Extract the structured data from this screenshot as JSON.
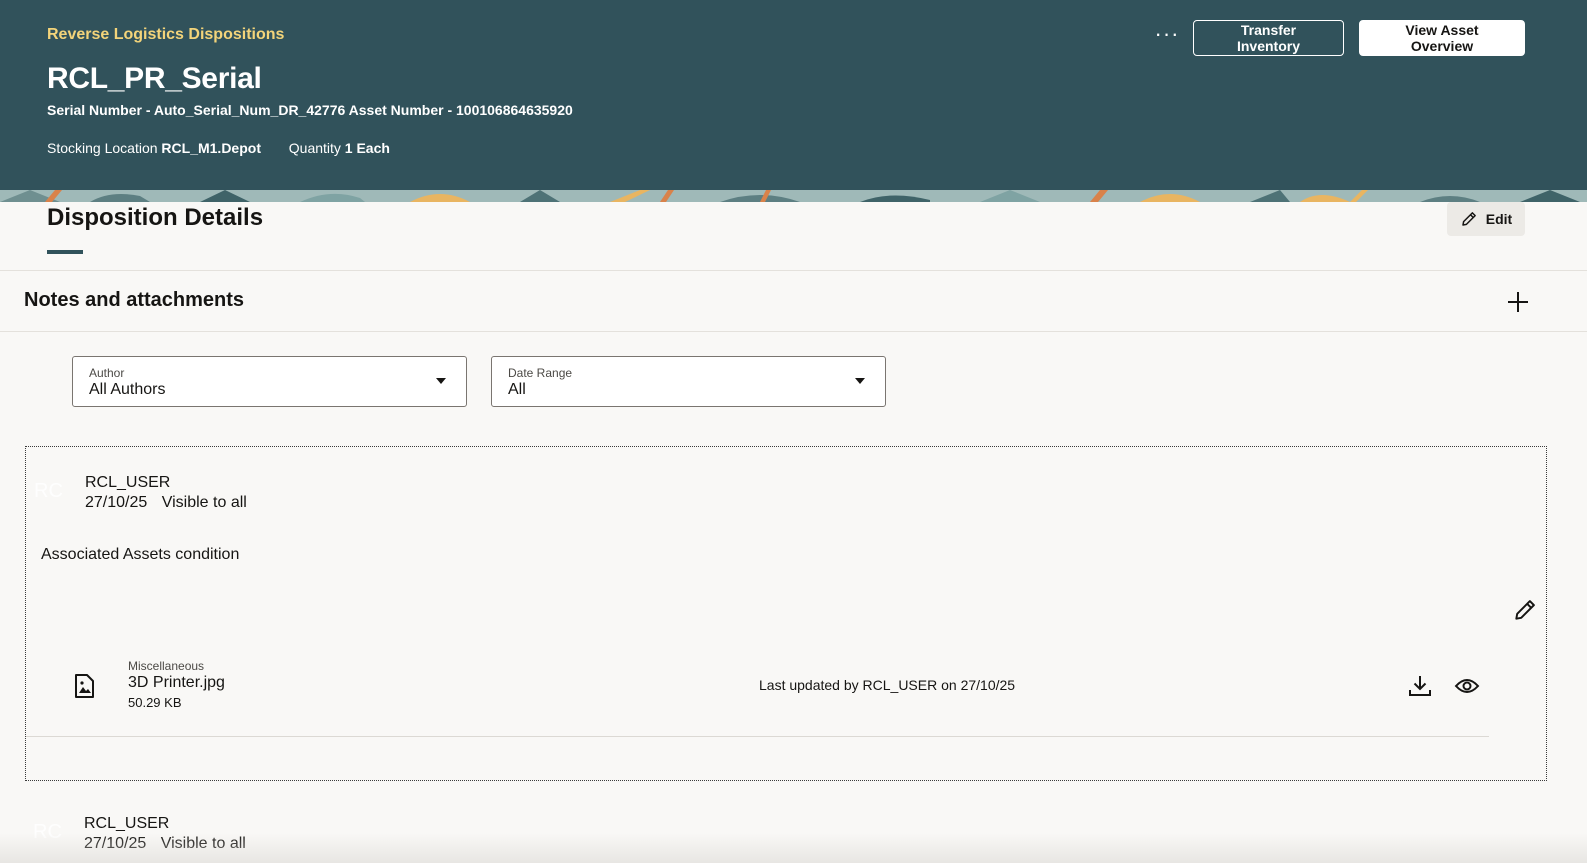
{
  "header": {
    "app_title": "Reverse Logistics Dispositions",
    "page_title": "RCL_PR_Serial",
    "subtitle": "Serial Number - Auto_Serial_Num_DR_42776 Asset Number - 100106864635920",
    "stocking_location_label": "Stocking Location",
    "stocking_location_value": "RCL_M1.Depot",
    "quantity_label": "Quantity",
    "quantity_value": "1 Each",
    "more_label": "···",
    "transfer_label": "Transfer Inventory",
    "view_overview_label": "View Asset Overview"
  },
  "section": {
    "title": "Disposition Details",
    "edit_label": "Edit"
  },
  "notes": {
    "title": "Notes and attachments",
    "filters": {
      "author": {
        "label": "Author",
        "value": "All Authors"
      },
      "date_range": {
        "label": "Date Range",
        "value": "All"
      }
    },
    "items": [
      {
        "avatar": "RC",
        "author": "RCL_USER",
        "date": "27/10/25",
        "visibility": "Visible to all",
        "text": "Associated Assets condition",
        "attachment": {
          "category": "Miscellaneous",
          "name": "3D Printer.jpg",
          "size": "50.29 KB",
          "updated": "Last updated by RCL_USER on 27/10/25"
        }
      },
      {
        "avatar": "RC",
        "author": "RCL_USER",
        "date": "27/10/25",
        "visibility": "Visible to all"
      }
    ]
  },
  "colors": {
    "header_bg": "#31525b",
    "app_title": "#f3d47a",
    "accent_underline": "#31525b"
  },
  "icons": {
    "edit": "pencil-icon",
    "add": "plus-icon",
    "file": "image-file-icon",
    "download": "download-icon",
    "view": "eye-icon",
    "dropdown": "caret-down-icon"
  }
}
